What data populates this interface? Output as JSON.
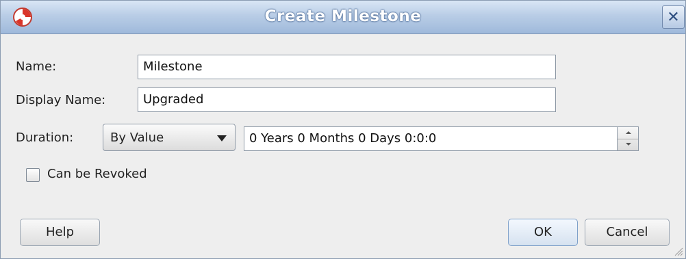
{
  "window": {
    "title": "Create Milestone",
    "close_glyph": "✕"
  },
  "form": {
    "name_label": "Name:",
    "name_value": "Milestone",
    "display_name_label": "Display Name:",
    "display_name_value": "Upgraded",
    "duration_label": "Duration:",
    "duration_mode": "By Value",
    "duration_value": "0 Years 0 Months 0 Days 0:0:0",
    "revoke_label": "Can be Revoked",
    "revoke_checked": false
  },
  "buttons": {
    "help": "Help",
    "ok": "OK",
    "cancel": "Cancel"
  },
  "icons": [
    "app-icon",
    "close-icon",
    "dropdown-arrow-icon",
    "spinner-up-icon",
    "spinner-down-icon",
    "resize-grip-icon"
  ]
}
